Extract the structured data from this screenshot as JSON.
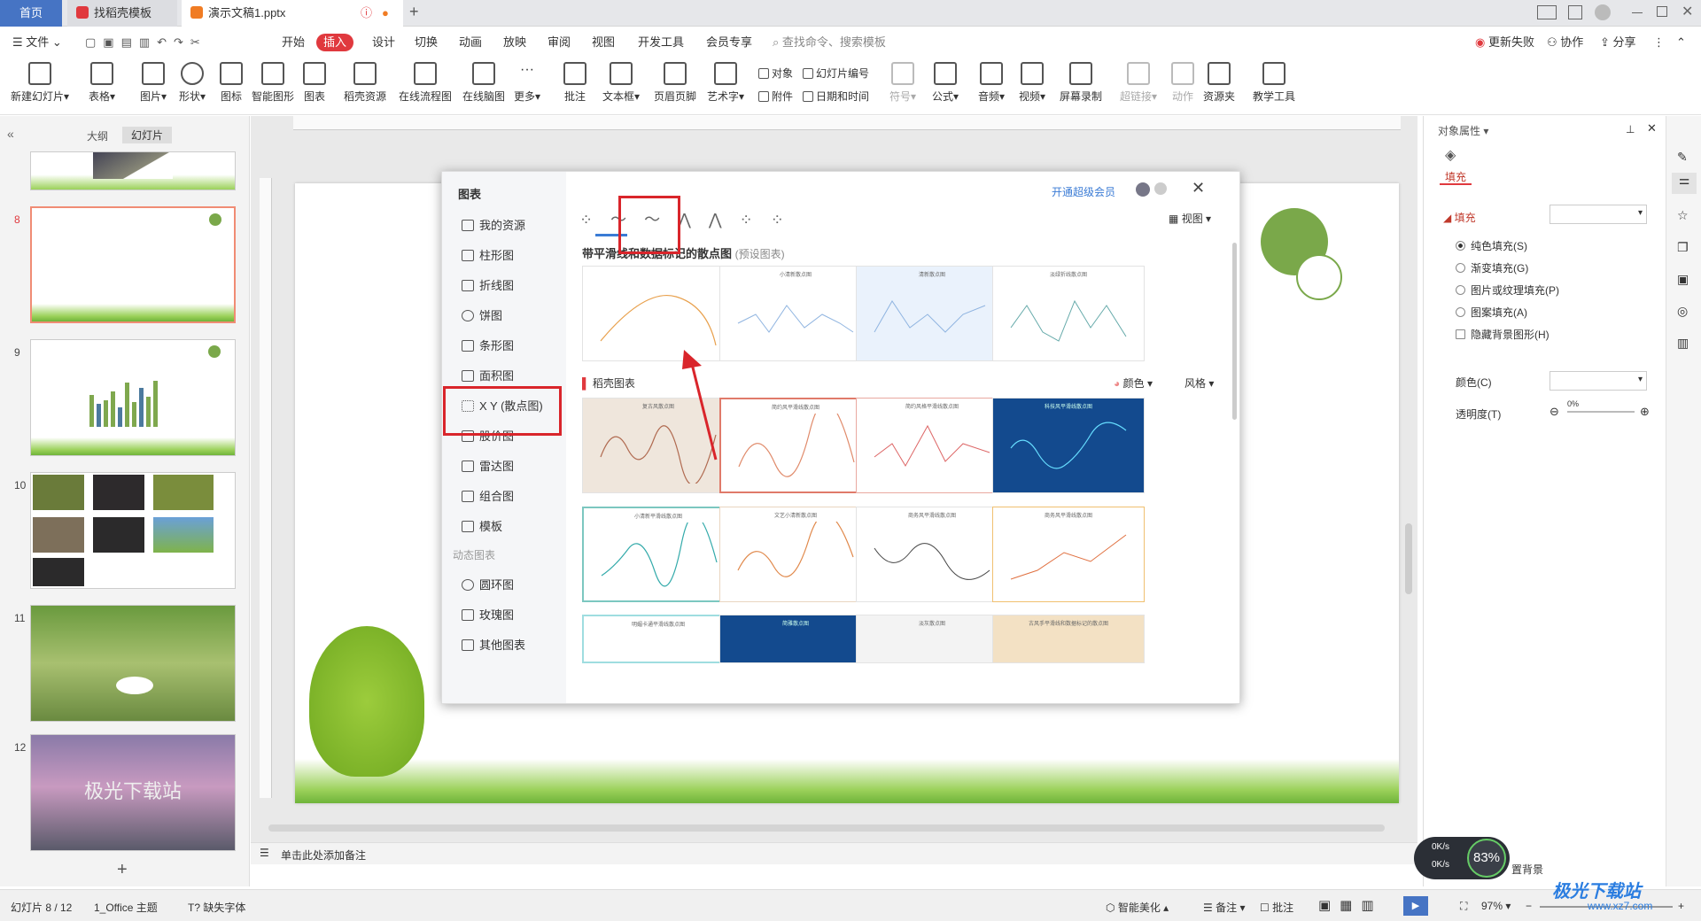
{
  "tabs": {
    "home": "首页",
    "template": "找稻壳模板",
    "doc": "演示文稿1.pptx"
  },
  "menu": {
    "file": "文件",
    "items": [
      "开始",
      "插入",
      "设计",
      "切换",
      "动画",
      "放映",
      "审阅",
      "视图",
      "开发工具",
      "会员专享"
    ],
    "search": "查找命令、搜索模板",
    "update": "更新失败",
    "collab": "协作",
    "share": "分享"
  },
  "ribbon": {
    "big": [
      "新建幻灯片",
      "表格",
      "图片",
      "形状",
      "图标",
      "智能图形",
      "图表",
      "稻壳资源",
      "在线流程图",
      "在线脑图",
      "更多",
      "批注",
      "文本框",
      "页眉页脚",
      "艺术字",
      "符号",
      "公式",
      "音频",
      "视频",
      "屏幕录制",
      "超链接",
      "动作",
      "资源夹",
      "教学工具"
    ],
    "small": [
      "对象",
      "幻灯片编号",
      "附件",
      "日期和时间"
    ]
  },
  "leftpane": {
    "tab_outline": "大纲",
    "tab_slides": "幻灯片",
    "slide_nums": [
      "8",
      "9",
      "10",
      "11",
      "12"
    ],
    "slide12_text": "极光下载站"
  },
  "dialog": {
    "title": "图表",
    "vip": "开通超级会员",
    "categories": [
      "我的资源",
      "柱形图",
      "折线图",
      "饼图",
      "条形图",
      "面积图",
      "X Y (散点图)",
      "股价图",
      "雷达图",
      "组合图",
      "模板"
    ],
    "dynamic_header": "动态图表",
    "dynamic": [
      "圆环图",
      "玫瑰图",
      "其他图表"
    ],
    "view": "视图",
    "section_title": "带平滑线和数据标记的散点图",
    "section_sub": "(预设图表)",
    "dk_title": "稻壳图表",
    "color": "颜色",
    "style": "风格",
    "preset_titles": [
      "",
      "小清新散点图",
      "清新散点图",
      "淡绿折线散点图"
    ],
    "dk_titles": [
      "复古风散点图",
      "简约风平滑线散点图",
      "简约风格平滑线散点图",
      "科技风平滑线散点图",
      "小清新平滑线散点图",
      "文艺小清新散点图",
      "商务风平滑线散点图",
      "商务风平滑线散点图",
      "明媚卡通平滑线散点图",
      "简雅散点图",
      "淡灰散点图",
      "古风手平滑线和数据标记的散点图"
    ]
  },
  "notes": "单击此处添加备注",
  "rightpane": {
    "title": "对象属性",
    "tab": "填充",
    "section": "填充",
    "options": [
      "纯色填充(S)",
      "渐变填充(G)",
      "图片或纹理填充(P)",
      "图案填充(A)"
    ],
    "hide_bg": "隐藏背景图形(H)",
    "color_label": "颜色(C)",
    "transp_label": "透明度(T)",
    "transp_val": "0%"
  },
  "status": {
    "slide": "幻灯片 8 / 12",
    "theme": "1_Office 主题",
    "font": "缺失字体",
    "beautify": "智能美化",
    "notes": "备注",
    "comment": "批注",
    "zoom": "97%"
  },
  "net": {
    "up": "0K/s",
    "down": "0K/s",
    "pct": "83%"
  },
  "watermark": "极光下载站",
  "watermark_url": "www.xz7.com",
  "bg_tip": "置背景"
}
